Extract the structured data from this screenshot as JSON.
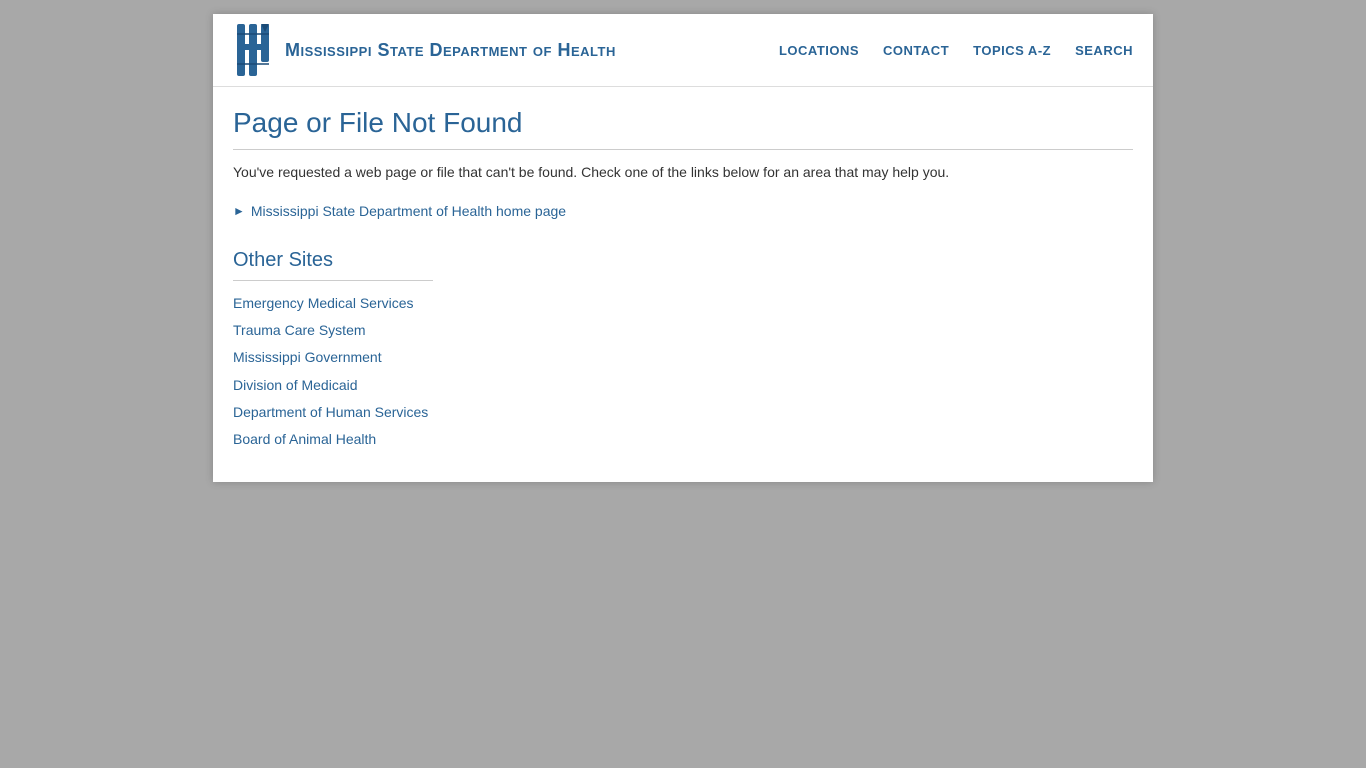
{
  "header": {
    "logo_text": "Mississippi State Department of Health",
    "nav": {
      "locations": "LOCATIONS",
      "contact": "CONTACT",
      "topics": "TOPICS A-Z",
      "search": "SEARCH"
    }
  },
  "main": {
    "page_title": "Page or File Not Found",
    "not_found_message": "You've requested a web page or file that can't be found. Check one of the links below for an area that may help you.",
    "home_link_label": "Mississippi State Department of Health home page"
  },
  "other_sites": {
    "title": "Other Sites",
    "links": [
      "Emergency Medical Services",
      "Trauma Care System",
      "Mississippi Government",
      "Division of Medicaid",
      "Department of Human Services",
      "Board of Animal Health"
    ]
  }
}
